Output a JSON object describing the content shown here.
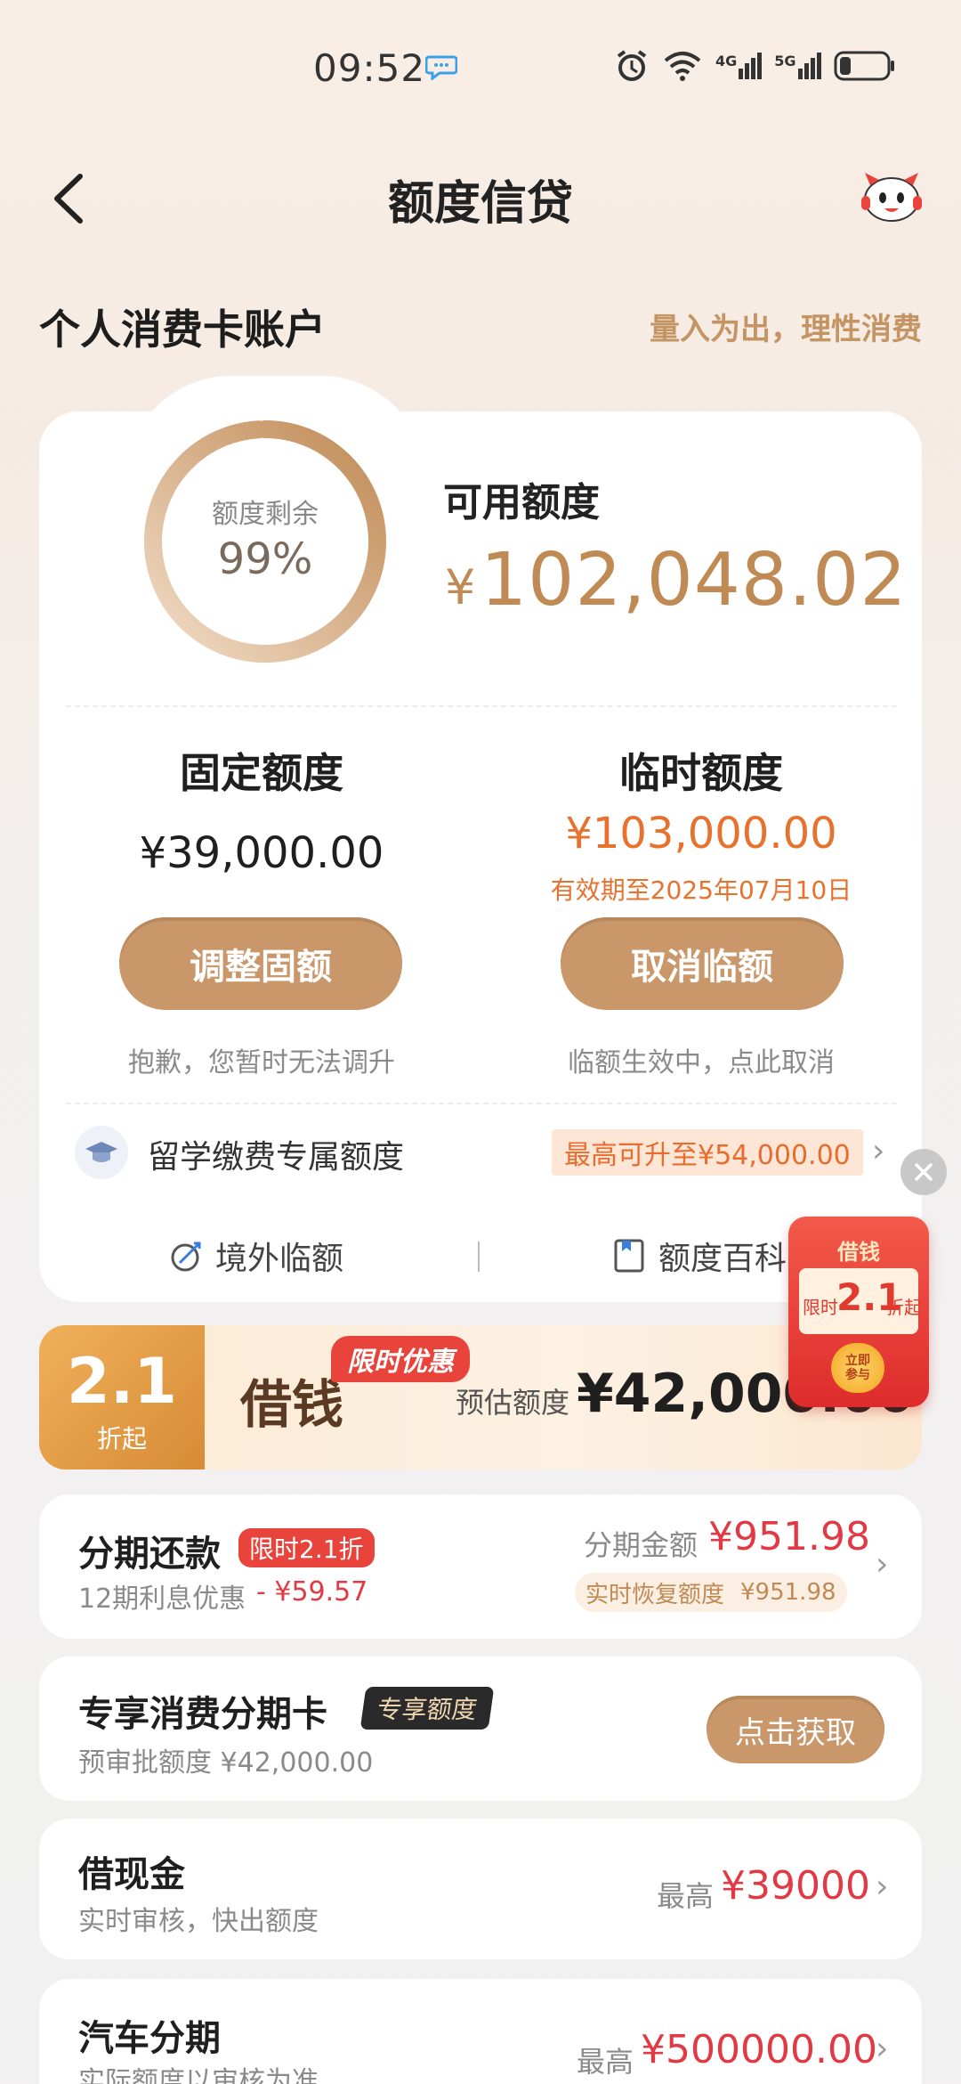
{
  "status_bar": {
    "time": "09:52",
    "net1": "4G",
    "net2": "5G"
  },
  "nav": {
    "title": "额度信贷"
  },
  "section": {
    "title": "个人消费卡账户",
    "slogan": "量入为出，理性消费"
  },
  "ring": {
    "label": "额度剩余",
    "value": "99%",
    "remaining_fraction": 0.99
  },
  "available": {
    "label": "可用额度",
    "currency": "¥",
    "value": "102,048.02"
  },
  "fixed": {
    "title": "固定额度",
    "amount": "¥39,000.00",
    "button": "调整固额",
    "hint": "抱歉，您暂时无法调升"
  },
  "temporary": {
    "title": "临时额度",
    "amount": "¥103,000.00",
    "valid": "有效期至2025年07月10日",
    "button": "取消临额",
    "hint": "临额生效中，点此取消"
  },
  "study": {
    "label": "留学缴费专属额度",
    "badge": "最高可升至¥54,000.00"
  },
  "links": {
    "overseas": "境外临额",
    "encyclopedia": "额度百科"
  },
  "promo": {
    "discount": "2.1",
    "discount_sub": "折起",
    "title": "借钱",
    "tag": "限时优惠",
    "est_label": "预估额度",
    "est_value": "¥42,000.00"
  },
  "float_coupon": {
    "title": "借钱",
    "pre": "限时",
    "num": "2.1",
    "post": "折起",
    "coin_line1": "立即",
    "coin_line2": "参与"
  },
  "installment": {
    "title": "分期还款",
    "tag": "限时2.1折",
    "sub_label": "12期利息优惠",
    "sub_value": "- ¥59.57",
    "amount_label": "分期金额",
    "amount_value": "¥951.98",
    "restore_label": "实时恢复额度",
    "restore_value": "¥951.98"
  },
  "card_offer": {
    "title": "专享消费分期卡",
    "tag": "专享额度",
    "sub": "预审批额度 ¥42,000.00",
    "button": "点击获取"
  },
  "cash": {
    "title": "借现金",
    "sub": "实时审核，快出额度",
    "max_label": "最高",
    "max_value": "¥39000"
  },
  "car": {
    "title": "汽车分期",
    "sub": "实际额度以审核为准",
    "max_label": "最高",
    "max_value": "¥500000.00"
  },
  "colors": {
    "accent": "#c9976a",
    "orange": "#e6722e",
    "red": "#e23a44"
  }
}
